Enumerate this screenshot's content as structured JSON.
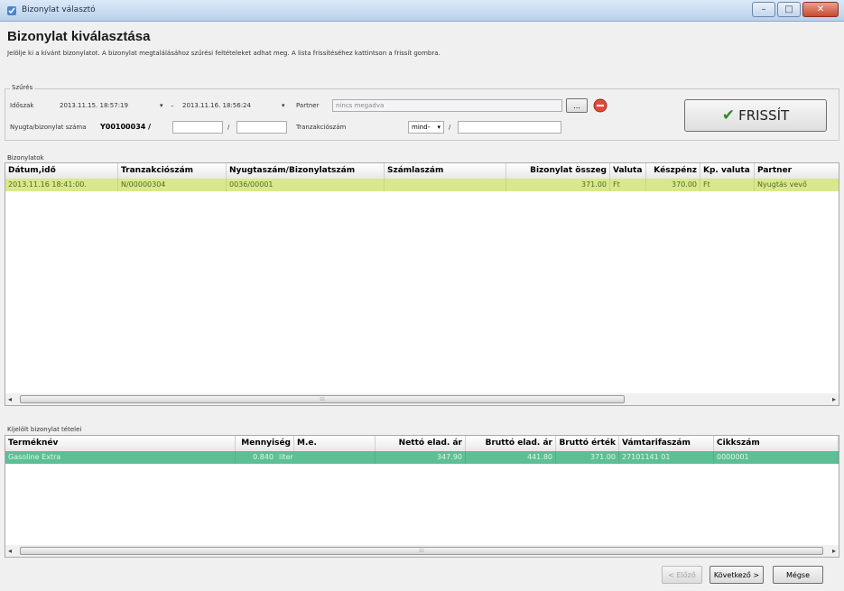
{
  "window": {
    "title": "Bizonylat választó"
  },
  "header": {
    "title": "Bizonylat kiválasztása",
    "description": "Jelölje ki a kívánt bizonylatot. A bizonylat megtalálásához szűrési feltételeket adhat meg. A lista frissítéséhez kattintson a frissít gombra."
  },
  "filter": {
    "group_label": "Szűrés",
    "period_label": "Időszak",
    "date_from": "2013.11.15. 18:57:19",
    "date_to": "2013.11.16. 18:56:24",
    "range_dash": "–",
    "partner_label": "Partner",
    "partner_value": "nincs megadva",
    "browse_label": "...",
    "receipt_label": "Nyugta/bizonylat száma",
    "receipt_prefix": "Y00100034 /",
    "receipt_sep": "/",
    "transaction_label": "Tranzakciószám",
    "transaction_combo": "mind-",
    "transaction_sep": "/",
    "refresh_label": "FRISSÍT"
  },
  "documents": {
    "group_label": "Bizonylatok",
    "columns": [
      "Dátum,idő",
      "Tranzakciószám",
      "Nyugtaszám/Bizonylatszám",
      "Számlaszám",
      "Bizonylat összeg",
      "Valuta",
      "Készpénz",
      "Kp. valuta",
      "Partner"
    ],
    "rows": [
      [
        "2013.11.16 18:41:00.",
        "N/00000304",
        "0036/00001",
        "",
        "371.00",
        "Ft",
        "370.00",
        "Ft",
        "Nyugtás vevő"
      ]
    ]
  },
  "items": {
    "group_label": "Kijelölt bizonylat tételei",
    "columns": [
      "Terméknév",
      "Mennyiség",
      "M.e.",
      "Nettó elad. ár",
      "Bruttó elad. ár",
      "Bruttó érték",
      "Vámtarifaszám",
      "Cikkszám"
    ],
    "rows": [
      [
        "Gasoline Extra",
        "0.840",
        "liter",
        "347.90",
        "441.80",
        "371.00",
        "27101141 01",
        "0000001"
      ]
    ]
  },
  "footer": {
    "back_label": "< Előző",
    "next_label": "Következő >",
    "cancel_label": "Mégse"
  },
  "colors": {
    "selected_row": "#d9e88c",
    "item_row": "#5cbf96",
    "refresh_check": "#2e8b2e"
  },
  "icons": [
    "app-icon",
    "minimize-icon",
    "maximize-icon",
    "close-icon",
    "clear-partner-icon",
    "checkmark-icon",
    "dropdown-arrow-icon",
    "scroll-left-icon",
    "scroll-right-icon"
  ]
}
